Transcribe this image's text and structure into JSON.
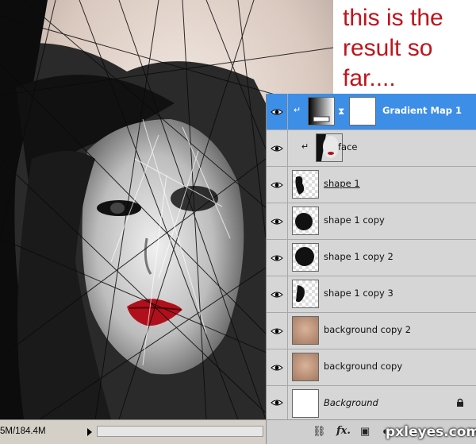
{
  "caption": "this is the\nresult so\nfar....",
  "status": {
    "doc_size": "5M/184.4M"
  },
  "layers": [
    {
      "name": "Gradient Map 1",
      "type": "adjustment",
      "selected": true,
      "clipped": true
    },
    {
      "name": "face",
      "type": "image",
      "selected": false,
      "clipped": true
    },
    {
      "name": "shape 1",
      "type": "brush",
      "selected": false,
      "clipped": false
    },
    {
      "name": "shape 1 copy",
      "type": "brush",
      "selected": false,
      "clipped": false
    },
    {
      "name": "shape 1 copy 2",
      "type": "brush",
      "selected": false,
      "clipped": false
    },
    {
      "name": "shape 1 copy 3",
      "type": "brush",
      "selected": false,
      "clipped": false
    },
    {
      "name": "background copy 2",
      "type": "skin",
      "selected": false,
      "clipped": false
    },
    {
      "name": "background copy",
      "type": "skin",
      "selected": false,
      "clipped": false
    },
    {
      "name": "Background",
      "type": "white",
      "selected": false,
      "locked": true
    }
  ],
  "footer": {
    "fx_label": "fx."
  },
  "watermark": "pxleyes.com",
  "colors": {
    "caption": "#c0141c",
    "selected": "#3d8ee6",
    "lips": "#b0101c",
    "skin": "#c9a186"
  },
  "icons": [
    "eye-icon",
    "lock-icon",
    "link-icon",
    "fx-icon",
    "mask-icon",
    "adjustment-icon"
  ]
}
